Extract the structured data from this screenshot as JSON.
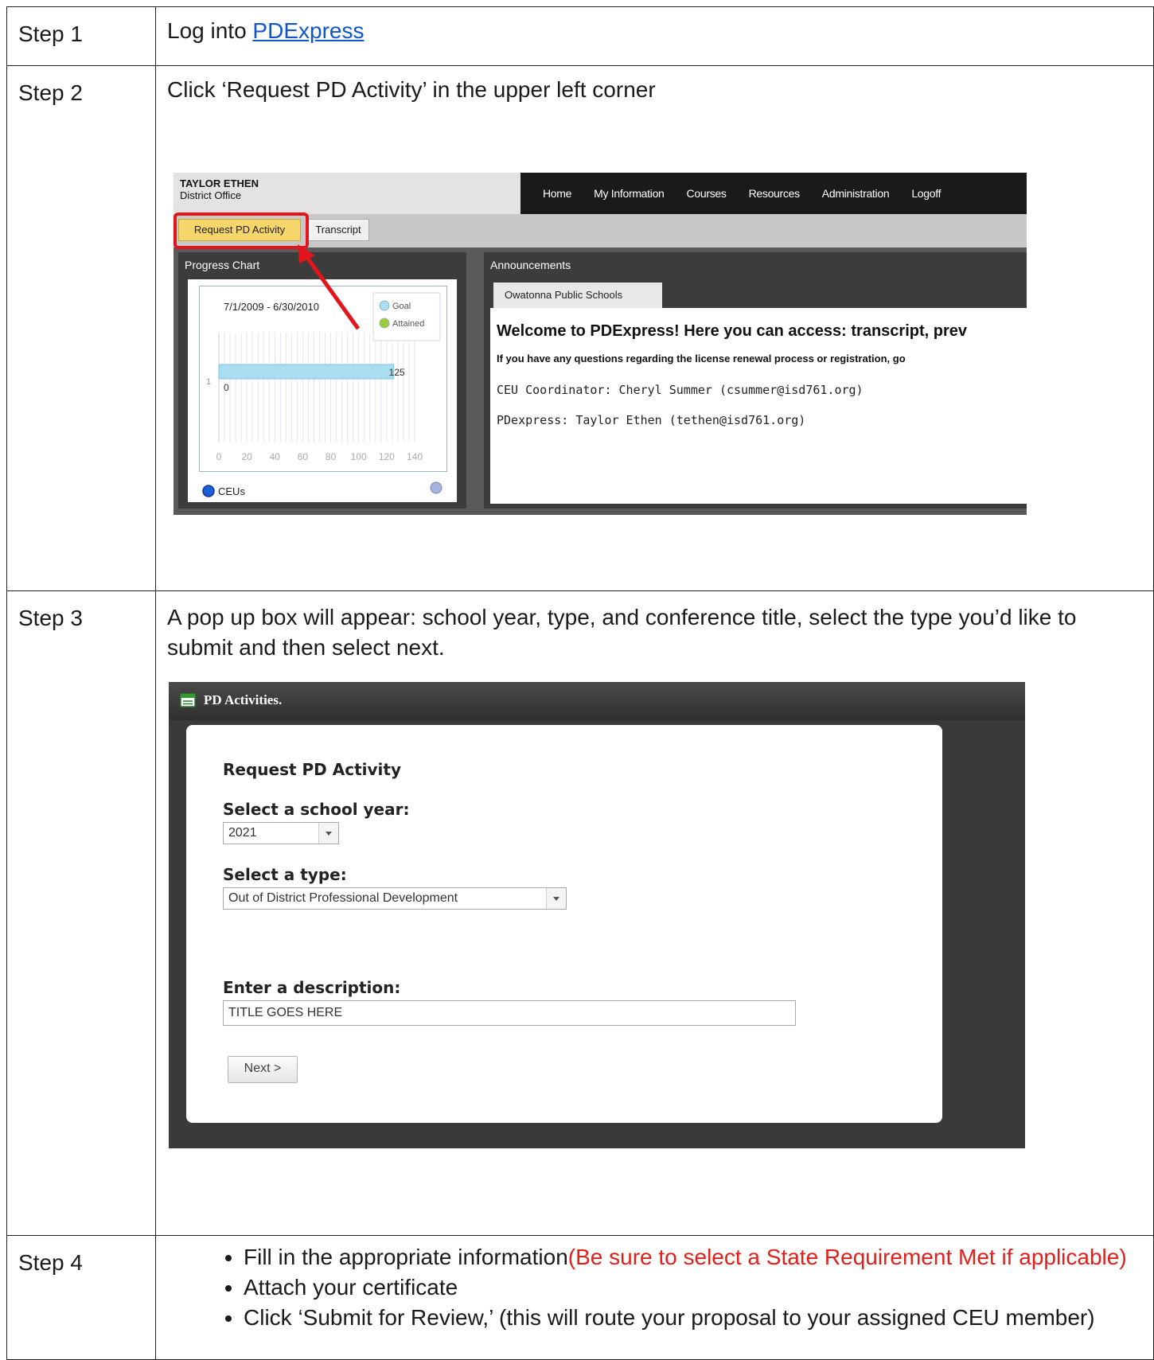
{
  "steps": [
    {
      "label": "Step 1",
      "text": "Log into ",
      "link": "PDExpress"
    },
    {
      "label": "Step 2",
      "text": "Click ‘Request PD Activity’ in the upper left corner"
    },
    {
      "label": "Step 3",
      "text": "A pop up box will appear: school year, type, and conference title, select the type you’d like to submit and then select next."
    },
    {
      "label": "Step 4",
      "bullets": [
        {
          "text": "Fill in the appropriate information",
          "note": "(Be sure to select a State Requirement Met if applicable)"
        },
        {
          "text": "Attach your certificate"
        },
        {
          "text": "Click ‘Submit for Review,’ (this will route your proposal to your assigned CEU member)"
        }
      ]
    }
  ],
  "dashboard": {
    "user_name": "TAYLOR ETHEN",
    "user_office": "District Office",
    "nav": [
      "Home",
      "My Information",
      "Courses",
      "Resources",
      "Administration",
      "Logoff"
    ],
    "tabs": {
      "request": "Request PD Activity",
      "transcript": "Transcript"
    },
    "progress_title": "Progress Chart",
    "announcements_title": "Announcements",
    "school_tab": "Owatonna Public Schools",
    "welcome": "Welcome to PDExpress! Here you can access: transcript, prev",
    "questions": "If you have any questions regarding the license renewal process or registration, go",
    "ceu_coordinator": "CEU Coordinator: Cheryl Summer (csummer@isd761.org)",
    "pdexpress_contact": "PDexpress: Taylor Ethen (tethen@isd761.org)",
    "radio_label": "CEUs",
    "highlight_color": "#e3141b"
  },
  "chart_data": {
    "type": "bar",
    "orientation": "horizontal",
    "title": "7/1/2009 - 6/30/2010",
    "categories": [
      "1"
    ],
    "series": [
      {
        "name": "Goal",
        "values": [
          125
        ],
        "color": "#a8def0"
      },
      {
        "name": "Attained",
        "values": [
          0
        ],
        "color": "#9ccc3c"
      }
    ],
    "xticks": [
      0,
      20,
      40,
      60,
      80,
      100,
      120,
      140
    ],
    "xlim": [
      0,
      140
    ],
    "data_labels": [
      "125",
      "0"
    ],
    "legend": "top-right",
    "grid": true
  },
  "dialog": {
    "title": "PD Activities.",
    "heading": "Request PD Activity",
    "year_label": "Select a school year:",
    "year_value": "2021",
    "type_label": "Select a type:",
    "type_value": "Out of District Professional Development",
    "desc_label": "Enter a description:",
    "desc_value": "TITLE GOES HERE",
    "next_label": "Next >"
  }
}
